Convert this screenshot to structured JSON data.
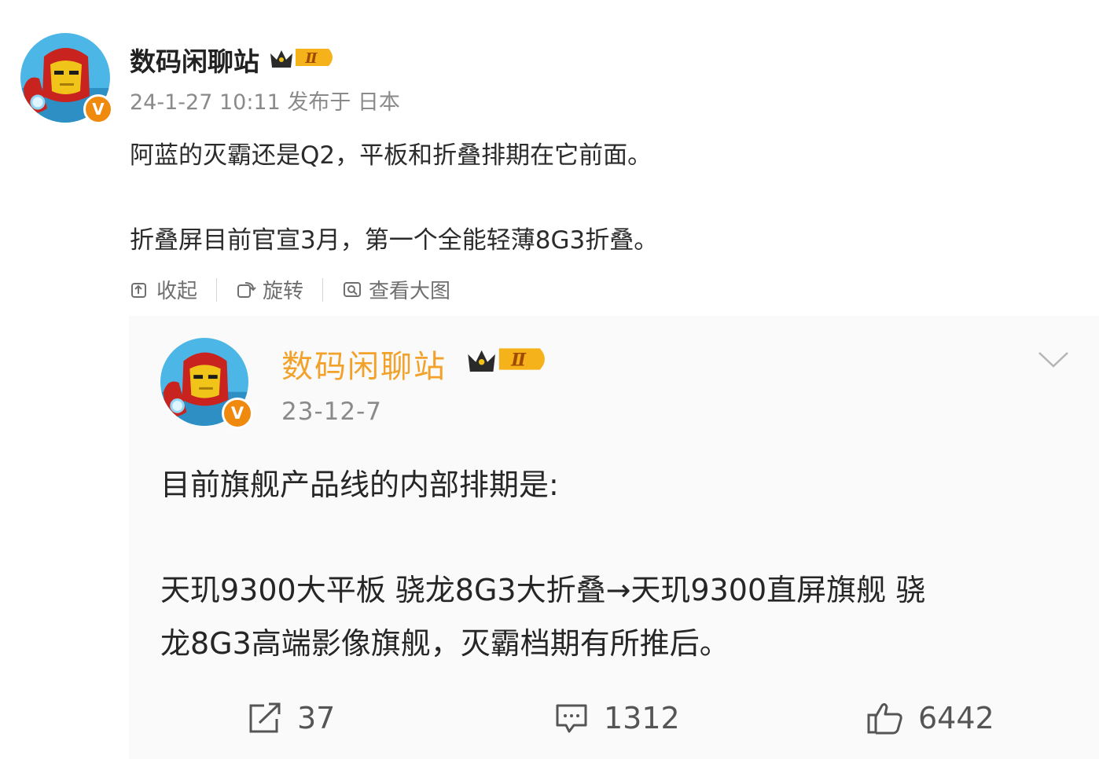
{
  "post": {
    "author": "数码闲聊站",
    "timestamp": "24-1-27 10:11",
    "location_prefix": "发布于",
    "location": "日本",
    "meta": "24-1-27 10:11 发布于 日本",
    "level_badge": "Ⅱ",
    "verified_icon": "v-badge-icon",
    "text_lines": [
      "阿蓝的灭霸还是Q2，平板和折叠排期在它前面。",
      "折叠屏目前官宣3月，第一个全能轻薄8G3折叠。"
    ],
    "actions": {
      "collapse": "收起",
      "rotate": "旋转",
      "view_large": "查看大图"
    }
  },
  "embedded": {
    "author": "数码闲聊站",
    "date": "23-12-7",
    "level_badge": "Ⅱ",
    "text_lines": [
      "目前旗舰产品线的内部排期是:",
      "天玑9300大平板 骁龙8G3大折叠→天玑9300直屏旗舰 骁",
      "龙8G3高端影像旗舰，灭霸档期有所推后。"
    ],
    "stats": {
      "reposts": "37",
      "comments": "1312",
      "likes": "6442"
    }
  },
  "colors": {
    "name_orange": "#f2a22a",
    "badge_orange": "#f08a0f",
    "text_dark": "#262626",
    "text_gray": "#8a8a8a",
    "embed_bg": "#fafafa"
  }
}
